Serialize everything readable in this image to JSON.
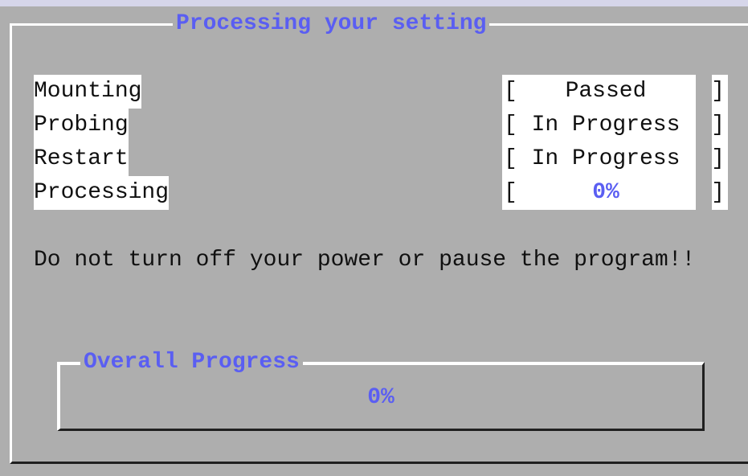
{
  "dialog": {
    "title": "Processing your setting"
  },
  "tasks": [
    {
      "label": "Mounting",
      "status": "Passed"
    },
    {
      "label": "Probing",
      "status": "In Progress"
    },
    {
      "label": "Restart",
      "status": "In Progress"
    },
    {
      "label": "Processing",
      "status": "0%"
    }
  ],
  "brackets": {
    "open": "[",
    "close": "]"
  },
  "warning": "Do not turn off your power or pause the program!!",
  "overall_progress": {
    "title": "Overall Progress",
    "value_text": "0%",
    "fraction": 0
  },
  "colors": {
    "accent": "#5a5ef2",
    "background": "#aeaeae",
    "text": "#101010"
  }
}
